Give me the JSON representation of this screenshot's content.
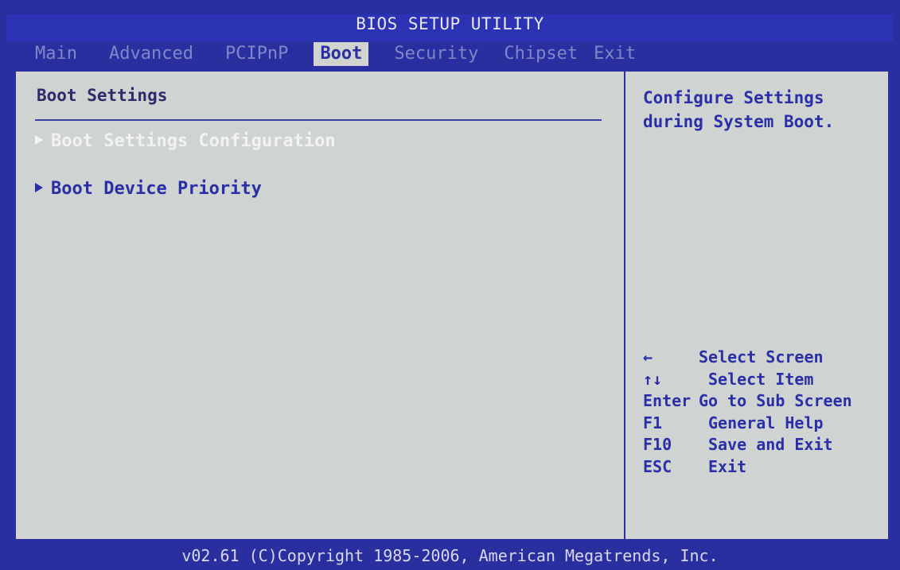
{
  "header": {
    "title": "BIOS SETUP UTILITY"
  },
  "menu": {
    "items": [
      {
        "label": "Main"
      },
      {
        "label": "Advanced"
      },
      {
        "label": "PCIPnP"
      },
      {
        "label": "Boot"
      },
      {
        "label": "Security"
      },
      {
        "label": "Chipset"
      },
      {
        "label": "Exit"
      }
    ],
    "active_index": 3
  },
  "main": {
    "section_title": "Boot Settings",
    "entries": [
      {
        "label": "Boot Settings Configuration",
        "selected": true
      },
      {
        "label": "Boot Device Priority",
        "selected": false
      }
    ]
  },
  "help": {
    "text": "Configure Settings during System Boot."
  },
  "keys": [
    {
      "key": "←",
      "desc": "Select Screen"
    },
    {
      "key": "↑↓",
      "desc": "Select Item"
    },
    {
      "key": "Enter",
      "desc": "Go to Sub Screen"
    },
    {
      "key": "F1",
      "desc": "General Help"
    },
    {
      "key": "F10",
      "desc": "Save and Exit"
    },
    {
      "key": "ESC",
      "desc": "Exit"
    }
  ],
  "footer": {
    "copyright": "v02.61 (C)Copyright 1985-2006, American Megatrends, Inc."
  },
  "colors": {
    "background_blue": "#2a2fa0",
    "panel_gray": "#cfd3d1",
    "menu_inactive": "#7e88c8",
    "highlight_text": "#f2f2f2",
    "text_blue": "#2a2fa8"
  }
}
